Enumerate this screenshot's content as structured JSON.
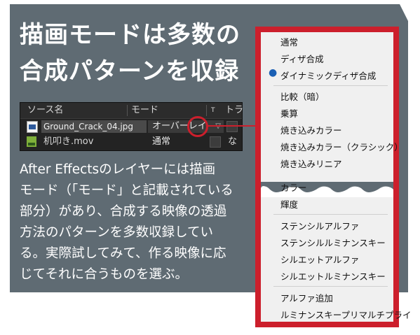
{
  "headline": [
    "描画モードは多数の",
    "合成パターンを収録"
  ],
  "layer_panel": {
    "columns": {
      "source_name": "ソース名",
      "mode": "モード",
      "t": "T",
      "track": "トラ"
    },
    "layers": [
      {
        "name": "Ground_Crack_04.jpg",
        "mode": "オーバーレイ",
        "extra": ""
      },
      {
        "name": "机叩き.mov",
        "mode": "通常",
        "extra": "な"
      }
    ]
  },
  "body_text": [
    "After Effectsのレイヤーには描画",
    "モード（「モード」と記載されている",
    "部分）があり、合成する映像の透過",
    "方法のパターンを多数収録してい",
    "る。実際試してみて、作る映像に応",
    "じてそれに合うものを選ぶ。"
  ],
  "blend_menu": {
    "groups": [
      [
        "通常",
        "ディザ合成",
        "ダイナミックディザ合成"
      ],
      [
        "比較（暗）",
        "乗算",
        "焼き込みカラー",
        "焼き込みカラー（クラシック）",
        "焼き込みリニア"
      ],
      [
        "カラー",
        "輝度"
      ],
      [
        "ステンシルアルファ",
        "ステンシルルミナンスキー",
        "シルエットアルファ",
        "シルエットルミナンスキー"
      ],
      [
        "アルファ追加",
        "ルミナンスキープリマルチプライ"
      ]
    ],
    "selected": "通常"
  },
  "colors": {
    "panel": "#5f6b73",
    "accent": "#cc1f2c",
    "menu_bg": "#f0f0f0"
  }
}
